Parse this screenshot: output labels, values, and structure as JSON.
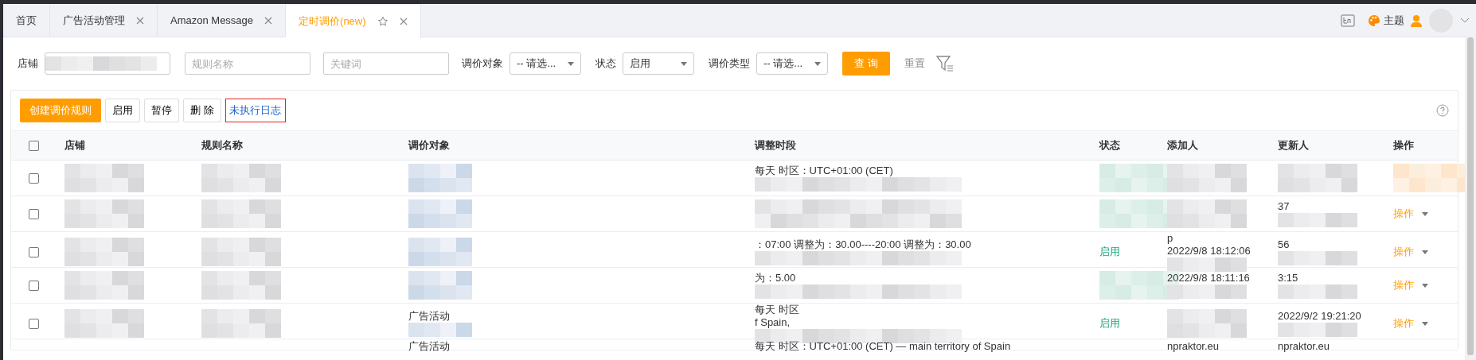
{
  "tabs": [
    {
      "label": "首页",
      "closable": false,
      "selected": false
    },
    {
      "label": "广告活动管理",
      "closable": true,
      "selected": false
    },
    {
      "label": "Amazon Message",
      "closable": true,
      "selected": false
    },
    {
      "label": "定时调价(new)",
      "closable": true,
      "selected": true,
      "starred": false
    }
  ],
  "header": {
    "theme_label": "主题"
  },
  "filters": [
    {
      "kind": "store",
      "label": "店铺"
    },
    {
      "kind": "input",
      "placeholder": "规则名称"
    },
    {
      "kind": "input",
      "placeholder": "关键词"
    },
    {
      "kind": "select",
      "label": "调价对象",
      "value": "-- 请选..."
    },
    {
      "kind": "select",
      "label": "状态",
      "value": "启用"
    },
    {
      "kind": "select",
      "label": "调价类型",
      "value": "-- 请选..."
    }
  ],
  "query_button": "查 询",
  "reset_button": "重置",
  "toolbar": [
    {
      "kind": "primary",
      "label": "创建调价规则"
    },
    {
      "kind": "default",
      "label": "启用"
    },
    {
      "kind": "default",
      "label": "暂停"
    },
    {
      "kind": "default",
      "label": "删 除"
    },
    {
      "kind": "link",
      "label": "未执行日志"
    }
  ],
  "table": {
    "all_checked": false,
    "columns": [
      "店铺",
      "规则名称",
      "调价对象",
      "调整时段",
      "状态",
      "添加人",
      "更新人",
      "操作"
    ],
    "rows": [
      {
        "kind": "full",
        "checked": false,
        "cells": [
          {
            "blurred": true
          },
          {
            "blurred": true
          },
          {
            "blurred": true
          },
          {
            "lines": [
              "每天 时区：UTC+01:00 (CET)"
            ],
            "blurred": true
          },
          {
            "blurred": true
          },
          {
            "blurred": true
          },
          {
            "blurred": true
          },
          {
            "blurred": true
          }
        ]
      },
      {
        "kind": "full",
        "checked": false,
        "cells": [
          {
            "blurred": true
          },
          {
            "blurred": true
          },
          {
            "blurred": true
          },
          {
            "blurred": true
          },
          {
            "blurred": true
          },
          {
            "blurred": true
          },
          {
            "lines": [
              "37"
            ],
            "blurred": true
          },
          {
            "lines": [
              "操作"
            ]
          }
        ]
      },
      {
        "kind": "full",
        "checked": false,
        "cells": [
          {
            "blurred": true
          },
          {
            "blurred": true
          },
          {
            "blurred": true
          },
          {
            "lines": [
              "：07:00 调整为：30.00----20:00 调整为：30.00"
            ],
            "blurred": true
          },
          {
            "lines": [
              "启用"
            ]
          },
          {
            "lines": [
              "p",
              "2022/9/8 18:12:06"
            ],
            "blurred": true
          },
          {
            "lines": [
              "56"
            ],
            "blurred": true
          },
          {
            "lines": [
              "操作"
            ]
          }
        ]
      },
      {
        "kind": "full",
        "checked": false,
        "cells": [
          {
            "blurred": true
          },
          {
            "blurred": true
          },
          {
            "blurred": true
          },
          {
            "lines": [
              "为：5.00"
            ],
            "blurred": true
          },
          {
            "blurred": true
          },
          {
            "lines": [
              "2022/9/8 18:11:16"
            ],
            "blurred": true
          },
          {
            "lines": [
              "3:15"
            ],
            "blurred": true
          },
          {
            "lines": [
              "操作"
            ]
          }
        ]
      },
      {
        "kind": "full",
        "checked": false,
        "cells": [
          {
            "blurred": true
          },
          {
            "blurred": true
          },
          {
            "lines": [
              "广告活动"
            ],
            "blurred": true
          },
          {
            "lines": [
              "每天 时区",
              "f Spain,"
            ],
            "blurred": true
          },
          {
            "lines": [
              "启用"
            ]
          },
          {
            "blurred": true
          },
          {
            "lines": [
              "2022/9/2 19:21:20"
            ],
            "blurred": true
          },
          {
            "lines": [
              "操作"
            ]
          }
        ]
      },
      {
        "kind": "partial",
        "cells": [
          {},
          {},
          {
            "lines": [
              "广告活动"
            ]
          },
          {
            "lines": [
              "每天 时区：UTC+01:00 (CET) — main territory of Spain"
            ]
          },
          {},
          {
            "lines": [
              "npraktor.eu"
            ]
          },
          {
            "lines": [
              "npraktor.eu"
            ]
          },
          {}
        ]
      }
    ]
  }
}
